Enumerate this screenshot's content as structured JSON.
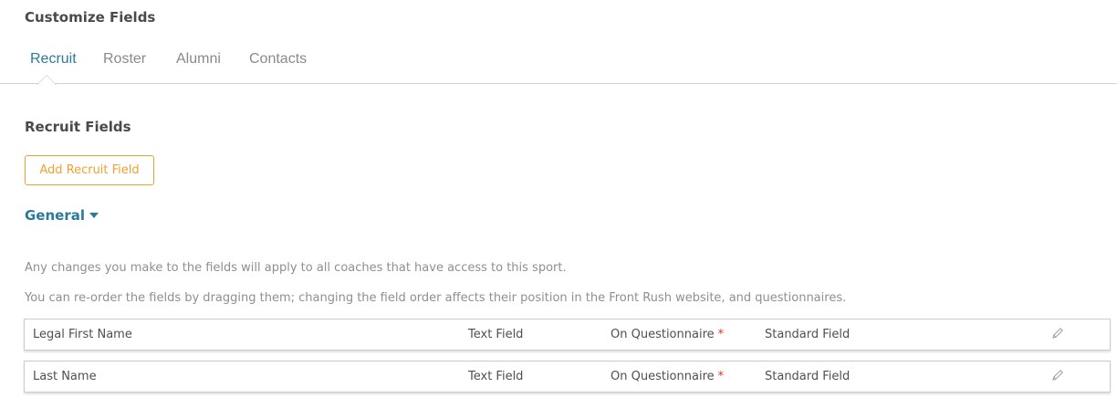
{
  "page": {
    "title": "Customize Fields"
  },
  "tabs": [
    {
      "label": "Recruit",
      "active": true
    },
    {
      "label": "Roster",
      "active": false
    },
    {
      "label": "Alumni",
      "active": false
    },
    {
      "label": "Contacts",
      "active": false
    }
  ],
  "section": {
    "title": "Recruit Fields",
    "add_button_label": "Add Recruit Field"
  },
  "group": {
    "label": "General",
    "icon": "caret-down-icon"
  },
  "info": {
    "line1": "Any changes you make to the fields will apply to all coaches that have access to this sport.",
    "line2": "You can re-order the fields by dragging them; changing the field order affects their position in the Front Rush website, and questionnaires."
  },
  "fields": [
    {
      "name": "Legal First Name",
      "type": "Text Field",
      "questionnaire": "On Questionnaire",
      "required_mark": "*",
      "kind": "Standard Field",
      "edit_icon": "pencil-icon"
    },
    {
      "name": "Last Name",
      "type": "Text Field",
      "questionnaire": "On Questionnaire",
      "required_mark": "*",
      "kind": "Standard Field",
      "edit_icon": "pencil-icon"
    }
  ],
  "colors": {
    "accent": "#2a7a9a",
    "button": "#f0a030",
    "required": "#d9342b"
  }
}
